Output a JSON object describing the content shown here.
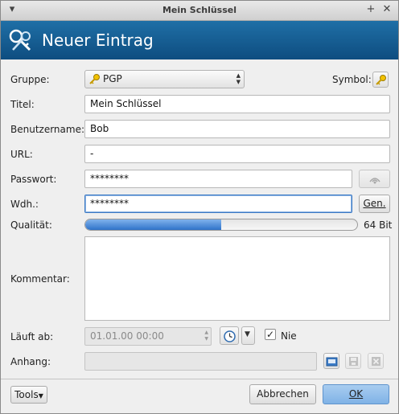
{
  "window": {
    "title": "Mein Schlüssel"
  },
  "header": {
    "title": "Neuer Eintrag"
  },
  "labels": {
    "group": "Gruppe:",
    "symbol": "Symbol:",
    "title": "Titel:",
    "username": "Benutzername:",
    "url": "URL:",
    "password": "Passwort:",
    "repeat": "Wdh.:",
    "quality": "Qualität:",
    "comment": "Kommentar:",
    "expires": "Läuft ab:",
    "attachment": "Anhang:"
  },
  "fields": {
    "group": "PGP",
    "title": "Mein Schlüssel",
    "username": "Bob",
    "url": "-",
    "password": "********",
    "repeat": "********",
    "expires": "01.01.00 00:00",
    "never_label": "Nie"
  },
  "quality": {
    "label": "64 Bit",
    "fraction": 0.5
  },
  "buttons": {
    "gen": "Gen.",
    "tools": "Tools",
    "cancel": "Abbrechen",
    "ok": "OK"
  },
  "colors": {
    "header": "#175f96",
    "progress": "#2f73c9"
  }
}
